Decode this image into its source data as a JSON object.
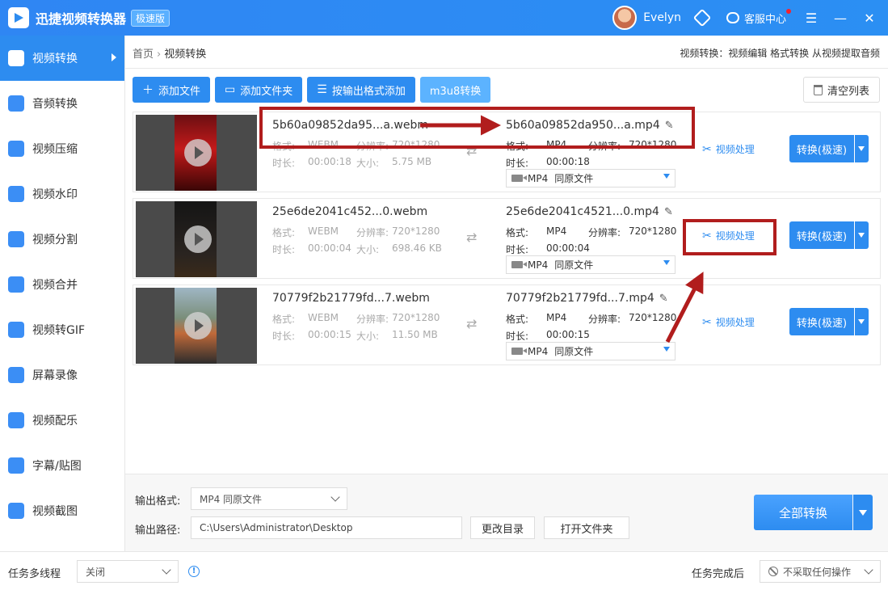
{
  "app": {
    "title": "迅捷视频转换器",
    "edition": "极速版",
    "user": "Evelyn",
    "service": "客服中心",
    "menu_icon": "☰",
    "minimize_icon": "—",
    "close_icon": "✕"
  },
  "sidebar": {
    "items": [
      {
        "label": "视频转换",
        "icon": "video-convert-icon",
        "active": true
      },
      {
        "label": "音频转换",
        "icon": "audio-convert-icon"
      },
      {
        "label": "视频压缩",
        "icon": "video-compress-icon"
      },
      {
        "label": "视频水印",
        "icon": "video-watermark-icon"
      },
      {
        "label": "视频分割",
        "icon": "video-split-icon"
      },
      {
        "label": "视频合并",
        "icon": "video-merge-icon"
      },
      {
        "label": "视频转GIF",
        "icon": "video-gif-icon"
      },
      {
        "label": "屏幕录像",
        "icon": "screen-record-icon"
      },
      {
        "label": "视频配乐",
        "icon": "video-music-icon"
      },
      {
        "label": "字幕/贴图",
        "icon": "subtitle-sticker-icon"
      },
      {
        "label": "视频截图",
        "icon": "video-screenshot-icon"
      }
    ]
  },
  "breadcrumb": {
    "home": "首页",
    "current": "视频转换"
  },
  "header_links": "视频转换：视频编辑 格式转换 从视频提取音频",
  "toolbar": {
    "add_file": "添加文件",
    "add_folder": "添加文件夹",
    "add_by_format": "按输出格式添加",
    "m3u8": "m3u8转换",
    "clear_list": "清空列表"
  },
  "labels": {
    "format": "格式:",
    "duration": "时长:",
    "resolution": "分辨率:",
    "size": "大小:",
    "process": "视频处理",
    "convert": "转换(极速)",
    "same_as_source": "同原文件"
  },
  "files": [
    {
      "src_name": "5b60a09852da95...a.webm",
      "src_format": "WEBM",
      "src_resolution": "720*1280",
      "src_duration": "00:00:18",
      "src_size": "5.75 MB",
      "dst_name": "5b60a09852da950...a.mp4",
      "dst_format": "MP4",
      "dst_resolution": "720*1280",
      "dst_duration": "00:00:18",
      "output_format": "MP4"
    },
    {
      "src_name": "25e6de2041c452...0.webm",
      "src_format": "WEBM",
      "src_resolution": "720*1280",
      "src_duration": "00:00:04",
      "src_size": "698.46 KB",
      "dst_name": "25e6de2041c4521...0.mp4",
      "dst_format": "MP4",
      "dst_resolution": "720*1280",
      "dst_duration": "00:00:04",
      "output_format": "MP4"
    },
    {
      "src_name": "70779f2b21779fd...7.webm",
      "src_format": "WEBM",
      "src_resolution": "720*1280",
      "src_duration": "00:00:15",
      "src_size": "11.50 MB",
      "dst_name": "70779f2b21779fd...7.mp4",
      "dst_format": "MP4",
      "dst_resolution": "720*1280",
      "dst_duration": "00:00:15",
      "output_format": "MP4"
    }
  ],
  "output": {
    "format_label": "输出格式:",
    "format_value": "MP4  同原文件",
    "path_label": "输出路径:",
    "path_value": "C:\\Users\\Administrator\\Desktop",
    "change_dir": "更改目录",
    "open_folder": "打开文件夹",
    "convert_all": "全部转换"
  },
  "statusbar": {
    "multithread_label": "任务多线程",
    "multithread_value": "关闭",
    "after_task_label": "任务完成后",
    "after_task_value": "不采取任何操作"
  },
  "colors": {
    "accent": "#2d8cf0",
    "annotation": "#b11d1d"
  }
}
